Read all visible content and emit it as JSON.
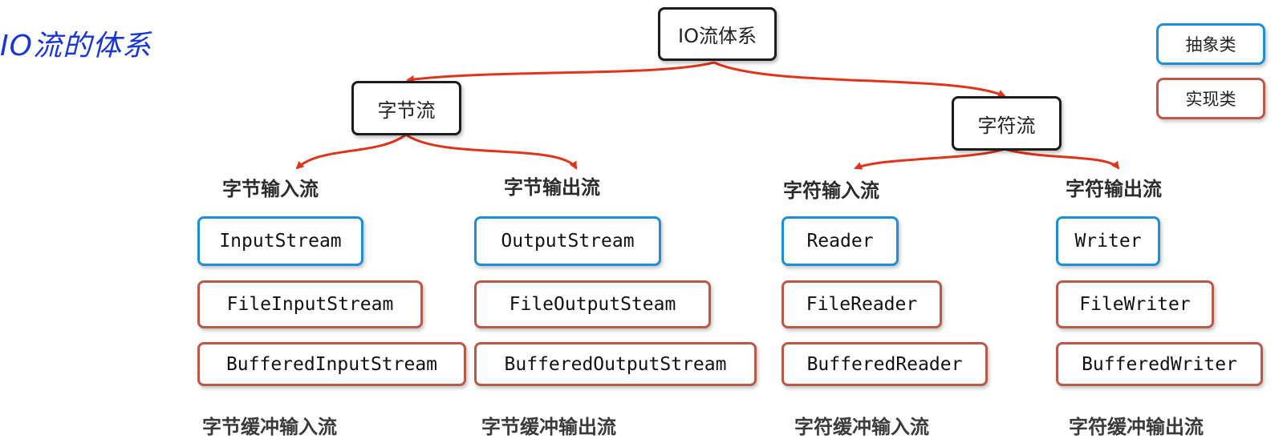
{
  "title": "IO流的体系",
  "colors": {
    "abstract_border": "#1e8fd6",
    "impl_border": "#b85a47",
    "arrow": "#e0341c",
    "title": "#1a36d6"
  },
  "legend": {
    "abstract": "抽象类",
    "impl": "实现类"
  },
  "root": "IO流体系",
  "byte_stream": {
    "label": "字节流",
    "input": {
      "heading": "字节输入流",
      "abstract_class": "InputStream",
      "impl_class": "FileInputStream",
      "buffered_class": "BufferedInputStream",
      "buffered_caption": "字节缓冲输入流"
    },
    "output": {
      "heading": "字节输出流",
      "abstract_class": "OutputStream",
      "impl_class": "FileOutputSteam",
      "buffered_class": "BufferedOutputStream",
      "buffered_caption": "字节缓冲输出流"
    }
  },
  "char_stream": {
    "label": "字符流",
    "input": {
      "heading": "字符输入流",
      "abstract_class": "Reader",
      "impl_class": "FileReader",
      "buffered_class": "BufferedReader",
      "buffered_caption": "字符缓冲输入流"
    },
    "output": {
      "heading": "字符输出流",
      "abstract_class": "Writer",
      "impl_class": "FileWriter",
      "buffered_class": "BufferedWriter",
      "buffered_caption": "字符缓冲输出流"
    }
  }
}
